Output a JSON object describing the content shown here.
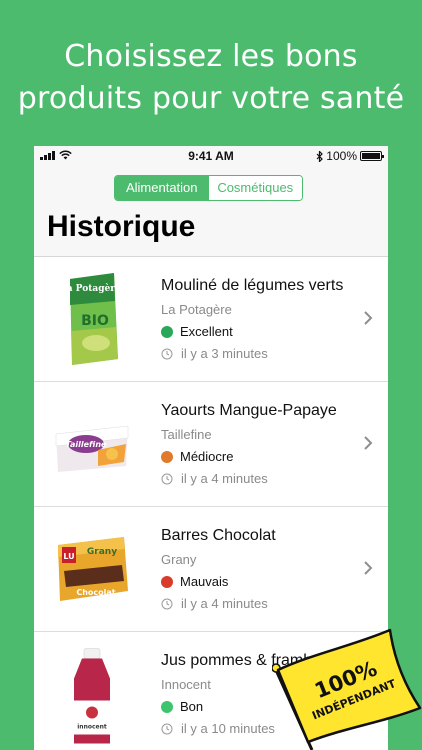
{
  "headline": {
    "line1": "Choisissez les bons",
    "line2": "produits pour votre santé"
  },
  "status_bar": {
    "time": "9:41 AM",
    "battery": "100%"
  },
  "segments": [
    {
      "label": "Alimentation",
      "active": true
    },
    {
      "label": "Cosmétiques",
      "active": false
    }
  ],
  "page_title": "Historique",
  "products": [
    {
      "name": "Mouliné de légumes verts",
      "brand": "La Potagère",
      "rating": "Excellent",
      "rating_color": "#2aa85a",
      "time": "il y a 3 minutes",
      "image_label": "la Potagère",
      "image_text": "BIO"
    },
    {
      "name": "Yaourts Mangue-Papaye",
      "brand": "Taillefine",
      "rating": "Médiocre",
      "rating_color": "#e07a2a",
      "time": "il y a 4 minutes",
      "image_label": "Taillefine",
      "image_text": ""
    },
    {
      "name": "Barres Chocolat",
      "brand": "Grany",
      "rating": "Mauvais",
      "rating_color": "#d93a2a",
      "time": "il y a 4 minutes",
      "image_label": "Grany",
      "image_text": "Chocolat"
    },
    {
      "name": "Jus pommes & framboises",
      "brand": "Innocent",
      "rating": "Bon",
      "rating_color": "#3ec46d",
      "time": "il y a 10 minutes",
      "image_label": "innocent",
      "image_text": ""
    }
  ],
  "badge": {
    "line1": "100%",
    "line2": "INDÉPENDANT"
  },
  "colors": {
    "brand_green": "#4cbb6e",
    "badge_yellow": "#ffe52e"
  }
}
